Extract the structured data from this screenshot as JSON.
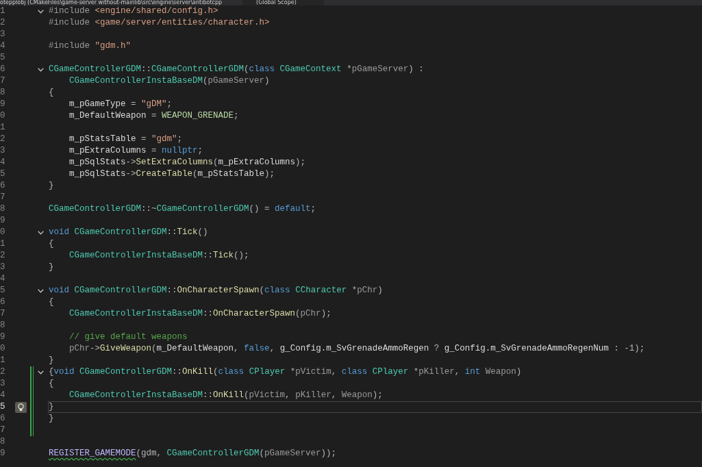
{
  "top_bar": {
    "file_path": "otepplobj (CMakeFiles\\game-server without-mainlib\\src\\engine\\server\\antibotcpp",
    "scope": "(Global Scope)"
  },
  "lines": [
    {
      "number": "1",
      "fold": true,
      "changed": false,
      "current": false,
      "tokens": [
        {
          "kind": "pp",
          "text": "#include "
        },
        {
          "kind": "inc",
          "text": "<engine/shared/config.h>"
        }
      ]
    },
    {
      "number": "2",
      "fold": false,
      "changed": false,
      "current": false,
      "tokens": [
        {
          "kind": "pp",
          "text": "#include "
        },
        {
          "kind": "inc",
          "text": "<game/server/entities/character.h>"
        }
      ]
    },
    {
      "number": "3",
      "fold": false,
      "changed": false,
      "current": false
    },
    {
      "number": "4",
      "fold": false,
      "changed": false,
      "current": false,
      "tokens": [
        {
          "kind": "pp",
          "text": "#include "
        },
        {
          "kind": "inc",
          "text": "\"gdm.h\""
        }
      ]
    },
    {
      "number": "5",
      "fold": false,
      "changed": false,
      "current": false
    },
    {
      "number": "6",
      "fold": true,
      "changed": false,
      "current": false,
      "tokens": [
        {
          "kind": "type",
          "text": "CGameControllerGDM"
        },
        {
          "kind": "p",
          "text": "::"
        },
        {
          "kind": "type",
          "text": "CGameControllerGDM"
        },
        {
          "kind": "p",
          "text": "("
        },
        {
          "kind": "kw",
          "text": "class "
        },
        {
          "kind": "type",
          "text": "CGameContext"
        },
        {
          "kind": "p",
          "text": " *"
        },
        {
          "kind": "param",
          "text": "pGameServer"
        },
        {
          "kind": "p",
          "text": ") :"
        }
      ]
    },
    {
      "number": "7",
      "fold": false,
      "changed": false,
      "current": false,
      "indented": true,
      "tokens": [
        {
          "kind": "type",
          "text": "CGameControllerInstaBaseDM"
        },
        {
          "kind": "p",
          "text": "("
        },
        {
          "kind": "param",
          "text": "pGameServer"
        },
        {
          "kind": "p",
          "text": ")"
        }
      ]
    },
    {
      "number": "8",
      "fold": false,
      "changed": false,
      "current": false,
      "tokens": [
        {
          "kind": "p",
          "text": "{"
        }
      ]
    },
    {
      "number": "9",
      "fold": false,
      "changed": false,
      "current": false,
      "indented": true,
      "tokens": [
        {
          "kind": "var",
          "text": "m_pGameType"
        },
        {
          "kind": "p",
          "text": " = "
        },
        {
          "kind": "str",
          "text": "\"gDM\""
        },
        {
          "kind": "p",
          "text": ";"
        }
      ]
    },
    {
      "number": "0",
      "fold": false,
      "changed": false,
      "current": false,
      "indented": true,
      "tokens": [
        {
          "kind": "var",
          "text": "m_DefaultWeapon"
        },
        {
          "kind": "p",
          "text": " = "
        },
        {
          "kind": "enum",
          "text": "WEAPON_GRENADE"
        },
        {
          "kind": "p",
          "text": ";"
        }
      ]
    },
    {
      "number": "1",
      "fold": false,
      "changed": false,
      "current": false
    },
    {
      "number": "2",
      "fold": false,
      "changed": false,
      "current": false,
      "indented": true,
      "tokens": [
        {
          "kind": "var",
          "text": "m_pStatsTable"
        },
        {
          "kind": "p",
          "text": " = "
        },
        {
          "kind": "str",
          "text": "\"gdm\""
        },
        {
          "kind": "p",
          "text": ";"
        }
      ]
    },
    {
      "number": "3",
      "fold": false,
      "changed": false,
      "current": false,
      "indented": true,
      "tokens": [
        {
          "kind": "var",
          "text": "m_pExtraColumns"
        },
        {
          "kind": "p",
          "text": " = "
        },
        {
          "kind": "kw",
          "text": "nullptr"
        },
        {
          "kind": "p",
          "text": ";"
        }
      ]
    },
    {
      "number": "4",
      "fold": false,
      "changed": false,
      "current": false,
      "indented": true,
      "tokens": [
        {
          "kind": "var",
          "text": "m_pSqlStats"
        },
        {
          "kind": "p",
          "text": "->"
        },
        {
          "kind": "fn",
          "text": "SetExtraColumns"
        },
        {
          "kind": "p",
          "text": "("
        },
        {
          "kind": "var",
          "text": "m_pExtraColumns"
        },
        {
          "kind": "p",
          "text": ");"
        }
      ]
    },
    {
      "number": "5",
      "fold": false,
      "changed": false,
      "current": false,
      "indented": true,
      "tokens": [
        {
          "kind": "var",
          "text": "m_pSqlStats"
        },
        {
          "kind": "p",
          "text": "->"
        },
        {
          "kind": "fn",
          "text": "CreateTable"
        },
        {
          "kind": "p",
          "text": "("
        },
        {
          "kind": "var",
          "text": "m_pStatsTable"
        },
        {
          "kind": "p",
          "text": ");"
        }
      ]
    },
    {
      "number": "6",
      "fold": false,
      "changed": false,
      "current": false,
      "tokens": [
        {
          "kind": "p",
          "text": "}"
        }
      ]
    },
    {
      "number": "7",
      "fold": false,
      "changed": false,
      "current": false
    },
    {
      "number": "8",
      "fold": false,
      "changed": false,
      "current": false,
      "tokens": [
        {
          "kind": "type",
          "text": "CGameControllerGDM"
        },
        {
          "kind": "p",
          "text": "::~"
        },
        {
          "kind": "type",
          "text": "CGameControllerGDM"
        },
        {
          "kind": "p",
          "text": "() = "
        },
        {
          "kind": "kw",
          "text": "default"
        },
        {
          "kind": "p",
          "text": ";"
        }
      ]
    },
    {
      "number": "9",
      "fold": false,
      "changed": false,
      "current": false
    },
    {
      "number": "0",
      "fold": true,
      "changed": false,
      "current": false,
      "tokens": [
        {
          "kind": "kw",
          "text": "void "
        },
        {
          "kind": "type",
          "text": "CGameControllerGDM"
        },
        {
          "kind": "p",
          "text": "::"
        },
        {
          "kind": "fn",
          "text": "Tick"
        },
        {
          "kind": "p",
          "text": "()"
        }
      ]
    },
    {
      "number": "1",
      "fold": false,
      "changed": false,
      "current": false,
      "tokens": [
        {
          "kind": "p",
          "text": "{"
        }
      ]
    },
    {
      "number": "2",
      "fold": false,
      "changed": false,
      "current": false,
      "indented": true,
      "tokens": [
        {
          "kind": "type",
          "text": "CGameControllerInstaBaseDM"
        },
        {
          "kind": "p",
          "text": "::"
        },
        {
          "kind": "fn",
          "text": "Tick"
        },
        {
          "kind": "p",
          "text": "();"
        }
      ]
    },
    {
      "number": "3",
      "fold": false,
      "changed": false,
      "current": false,
      "tokens": [
        {
          "kind": "p",
          "text": "}"
        }
      ]
    },
    {
      "number": "4",
      "fold": false,
      "changed": false,
      "current": false
    },
    {
      "number": "5",
      "fold": true,
      "changed": false,
      "current": false,
      "tokens": [
        {
          "kind": "kw",
          "text": "void "
        },
        {
          "kind": "type",
          "text": "CGameControllerGDM"
        },
        {
          "kind": "p",
          "text": "::"
        },
        {
          "kind": "fn",
          "text": "OnCharacterSpawn"
        },
        {
          "kind": "p",
          "text": "("
        },
        {
          "kind": "kw",
          "text": "class "
        },
        {
          "kind": "type",
          "text": "CCharacter"
        },
        {
          "kind": "p",
          "text": " *"
        },
        {
          "kind": "param",
          "text": "pChr"
        },
        {
          "kind": "p",
          "text": ")"
        }
      ]
    },
    {
      "number": "6",
      "fold": false,
      "changed": false,
      "current": false,
      "tokens": [
        {
          "kind": "p",
          "text": "{"
        }
      ]
    },
    {
      "number": "7",
      "fold": false,
      "changed": false,
      "current": false,
      "indented": true,
      "tokens": [
        {
          "kind": "type",
          "text": "CGameControllerInstaBaseDM"
        },
        {
          "kind": "p",
          "text": "::"
        },
        {
          "kind": "fn",
          "text": "OnCharacterSpawn"
        },
        {
          "kind": "p",
          "text": "("
        },
        {
          "kind": "param",
          "text": "pChr"
        },
        {
          "kind": "p",
          "text": ");"
        }
      ]
    },
    {
      "number": "8",
      "fold": false,
      "changed": false,
      "current": false
    },
    {
      "number": "9",
      "fold": false,
      "changed": false,
      "current": false,
      "indented": true,
      "tokens": [
        {
          "kind": "cmt",
          "text": "// give default weapons"
        }
      ]
    },
    {
      "number": "0",
      "fold": false,
      "changed": false,
      "current": false,
      "indented": true,
      "tokens": [
        {
          "kind": "param",
          "text": "pChr"
        },
        {
          "kind": "p",
          "text": "->"
        },
        {
          "kind": "fn",
          "text": "GiveWeapon"
        },
        {
          "kind": "p",
          "text": "("
        },
        {
          "kind": "var",
          "text": "m_DefaultWeapon"
        },
        {
          "kind": "p",
          "text": ", "
        },
        {
          "kind": "kw",
          "text": "false"
        },
        {
          "kind": "p",
          "text": ", "
        },
        {
          "kind": "var",
          "text": "g_Config.m_SvGrenadeAmmoRegen"
        },
        {
          "kind": "p",
          "text": " ? "
        },
        {
          "kind": "var",
          "text": "g_Config.m_SvGrenadeAmmoRegenNum"
        },
        {
          "kind": "p",
          "text": " : -1);"
        }
      ]
    },
    {
      "number": "1",
      "fold": false,
      "changed": false,
      "current": false,
      "tokens": [
        {
          "kind": "p",
          "text": "}"
        }
      ]
    },
    {
      "number": "2",
      "fold": true,
      "changed": true,
      "current": false,
      "tokens": [
        {
          "kind": "p",
          "text": "{"
        },
        {
          "kind": "kw",
          "text": "void "
        },
        {
          "kind": "type",
          "text": "CGameControllerGDM"
        },
        {
          "kind": "p",
          "text": "::"
        },
        {
          "kind": "fn",
          "text": "OnKill"
        },
        {
          "kind": "p",
          "text": "("
        },
        {
          "kind": "kw",
          "text": "class "
        },
        {
          "kind": "type",
          "text": "CPlayer"
        },
        {
          "kind": "p",
          "text": " *"
        },
        {
          "kind": "param",
          "text": "pVictim"
        },
        {
          "kind": "p",
          "text": ", "
        },
        {
          "kind": "kw",
          "text": "class "
        },
        {
          "kind": "type",
          "text": "CPlayer"
        },
        {
          "kind": "p",
          "text": " *"
        },
        {
          "kind": "param",
          "text": "pKiller"
        },
        {
          "kind": "p",
          "text": ", "
        },
        {
          "kind": "kw",
          "text": "int "
        },
        {
          "kind": "param",
          "text": "Weapon"
        },
        {
          "kind": "p",
          "text": ")"
        }
      ]
    },
    {
      "number": "3",
      "fold": false,
      "changed": true,
      "current": false,
      "tokens": [
        {
          "kind": "p",
          "text": "{"
        }
      ]
    },
    {
      "number": "4",
      "fold": false,
      "changed": true,
      "current": false,
      "indented": true,
      "tokens": [
        {
          "kind": "type",
          "text": "CGameControllerInstaBaseDM"
        },
        {
          "kind": "p",
          "text": "::"
        },
        {
          "kind": "fn",
          "text": "OnKill"
        },
        {
          "kind": "p",
          "text": "("
        },
        {
          "kind": "param",
          "text": "pVictim"
        },
        {
          "kind": "p",
          "text": ", "
        },
        {
          "kind": "param",
          "text": "pKiller"
        },
        {
          "kind": "p",
          "text": ", "
        },
        {
          "kind": "param",
          "text": "Weapon"
        },
        {
          "kind": "p",
          "text": ");"
        }
      ]
    },
    {
      "number": "5",
      "fold": false,
      "changed": true,
      "current": true,
      "lightbulb": true,
      "tokens": [
        {
          "kind": "p",
          "text": "}"
        }
      ]
    },
    {
      "number": "6",
      "fold": false,
      "changed": true,
      "current": false,
      "tokens": [
        {
          "kind": "p",
          "text": "}"
        }
      ]
    },
    {
      "number": "7",
      "fold": false,
      "changed": true,
      "current": false
    },
    {
      "number": "8",
      "fold": false,
      "changed": false,
      "current": false
    },
    {
      "number": "9",
      "fold": false,
      "changed": false,
      "current": false,
      "tokens": [
        {
          "kind": "macro",
          "text": "REGISTER_GAMEMODE"
        },
        {
          "kind": "p",
          "text": "(gdm, "
        },
        {
          "kind": "type",
          "text": "CGameControllerGDM"
        },
        {
          "kind": "p",
          "text": "("
        },
        {
          "kind": "param",
          "text": "pGameServer"
        },
        {
          "kind": "p",
          "text": "));"
        }
      ]
    }
  ]
}
